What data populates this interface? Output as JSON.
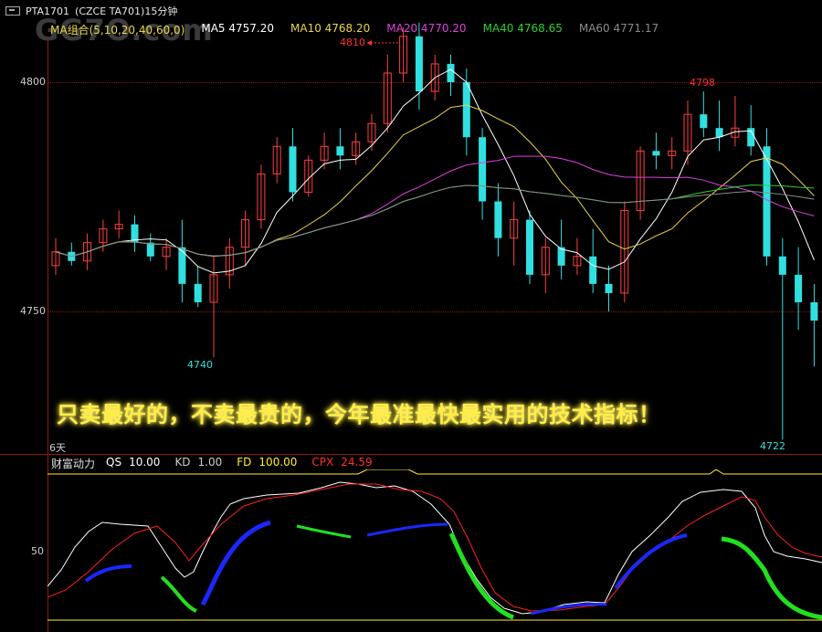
{
  "title": {
    "symbol": "PTA1701",
    "desc": "(CZCE TA701)15分钟"
  },
  "watermark": "GG7O.com",
  "ma_legend": [
    {
      "label": "MA组合(5,10,20,40,60,0)",
      "color": "#e8d44a"
    },
    {
      "label": "MA5 4757.20",
      "color": "#ffffff"
    },
    {
      "label": "MA10 4768.20",
      "color": "#e8d44a"
    },
    {
      "label": "MA20 4770.20",
      "color": "#e040e0"
    },
    {
      "label": "MA40 4768.65",
      "color": "#30d030"
    },
    {
      "label": "MA60 4771.17",
      "color": "#8a8a8a"
    }
  ],
  "price_axis": {
    "ticks": [
      "4800",
      "4750"
    ],
    "ymin": 4722,
    "ymax": 4813
  },
  "price_marks": [
    {
      "text": "4810",
      "color": "#ff3030",
      "value": 4810,
      "index": 22
    },
    {
      "text": "4798",
      "color": "#ff3030",
      "value": 4798,
      "index": 46
    },
    {
      "text": "4740",
      "color": "#30e0e0",
      "value": 4740,
      "index": 9
    },
    {
      "text": "4722",
      "color": "#30e0e0",
      "value": 4722,
      "index": 47
    }
  ],
  "banner": "只卖最好的，不卖最贵的，今年最准最快最实用的技术指标！",
  "days_label": "6天",
  "indicator": {
    "name": "财富动力",
    "fields": [
      {
        "k": "QS",
        "v": "10.00",
        "kc": "#ffffff",
        "vc": "#ffffff"
      },
      {
        "k": "KD",
        "v": "1.00",
        "kc": "#cccccc",
        "vc": "#cccccc"
      },
      {
        "k": "FD",
        "v": "100.00",
        "kc": "#ffee33",
        "vc": "#ffee33"
      },
      {
        "k": "CPX",
        "v": "24.59",
        "kc": "#ff3030",
        "vc": "#ff3030"
      }
    ],
    "tick": "50"
  },
  "colors": {
    "up": "#ff4040",
    "down": "#30e0e0",
    "doji": "#ffffff"
  },
  "chart_data": {
    "type": "candlestick",
    "candles": [
      [
        4760,
        4766,
        4758,
        4763
      ],
      [
        4763,
        4765,
        4760,
        4761
      ],
      [
        4761,
        4767,
        4759,
        4765
      ],
      [
        4765,
        4770,
        4763,
        4768
      ],
      [
        4768,
        4772,
        4766,
        4769
      ],
      [
        4769,
        4771,
        4763,
        4765
      ],
      [
        4765,
        4767,
        4761,
        4762
      ],
      [
        4762,
        4766,
        4759,
        4764
      ],
      [
        4764,
        4770,
        4752,
        4756
      ],
      [
        4756,
        4760,
        4751,
        4752
      ],
      [
        4752,
        4762,
        4740,
        4758
      ],
      [
        4758,
        4766,
        4755,
        4764
      ],
      [
        4764,
        4772,
        4760,
        4770
      ],
      [
        4770,
        4782,
        4768,
        4780
      ],
      [
        4780,
        4788,
        4778,
        4786
      ],
      [
        4786,
        4790,
        4774,
        4776
      ],
      [
        4776,
        4784,
        4775,
        4783
      ],
      [
        4783,
        4789,
        4781,
        4786
      ],
      [
        4786,
        4790,
        4781,
        4784
      ],
      [
        4784,
        4789,
        4782,
        4787
      ],
      [
        4787,
        4793,
        4785,
        4791
      ],
      [
        4791,
        4806,
        4789,
        4802
      ],
      [
        4802,
        4812,
        4800,
        4810
      ],
      [
        4810,
        4813,
        4794,
        4798
      ],
      [
        4798,
        4806,
        4796,
        4804
      ],
      [
        4804,
        4806,
        4797,
        4800
      ],
      [
        4800,
        4803,
        4784,
        4788
      ],
      [
        4788,
        4790,
        4770,
        4774
      ],
      [
        4774,
        4778,
        4762,
        4766
      ],
      [
        4766,
        4774,
        4760,
        4770
      ],
      [
        4770,
        4772,
        4756,
        4758
      ],
      [
        4758,
        4766,
        4754,
        4764
      ],
      [
        4764,
        4770,
        4757,
        4760
      ],
      [
        4760,
        4766,
        4758,
        4762
      ],
      [
        4762,
        4768,
        4754,
        4756
      ],
      [
        4756,
        4760,
        4750,
        4754
      ],
      [
        4754,
        4774,
        4752,
        4772
      ],
      [
        4772,
        4786,
        4770,
        4785
      ],
      [
        4785,
        4789,
        4781,
        4784
      ],
      [
        4784,
        4788,
        4781,
        4785
      ],
      [
        4785,
        4796,
        4782,
        4793
      ],
      [
        4793,
        4798,
        4788,
        4790
      ],
      [
        4790,
        4796,
        4785,
        4788
      ],
      [
        4788,
        4797,
        4786,
        4790
      ],
      [
        4790,
        4795,
        4784,
        4786
      ],
      [
        4786,
        4790,
        4760,
        4762
      ],
      [
        4762,
        4766,
        4722,
        4758
      ],
      [
        4758,
        4764,
        4746,
        4752
      ],
      [
        4752,
        4756,
        4738,
        4748
      ]
    ]
  }
}
